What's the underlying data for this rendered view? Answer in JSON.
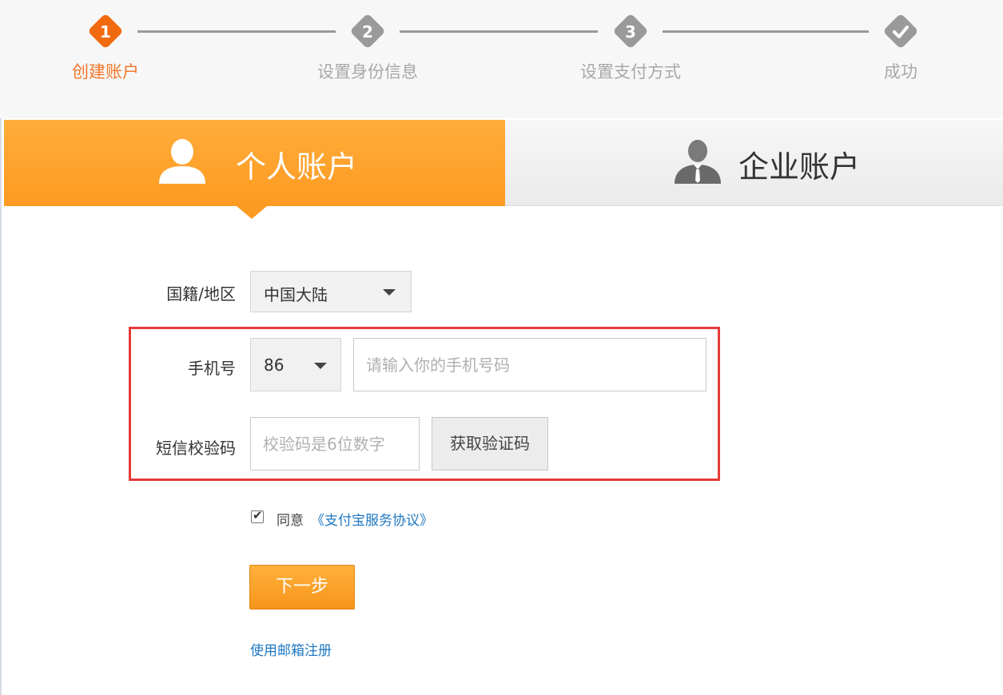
{
  "stepper": {
    "steps": [
      {
        "num": "1",
        "label": "创建账户",
        "state": "active"
      },
      {
        "num": "2",
        "label": "设置身份信息",
        "state": "pending"
      },
      {
        "num": "3",
        "label": "设置支付方式",
        "state": "pending"
      },
      {
        "num": "",
        "label": "成功",
        "state": "pending",
        "icon": "check-icon"
      }
    ]
  },
  "tabs": {
    "personal": {
      "label": "个人账户",
      "icon": "person-icon",
      "selected": true
    },
    "business": {
      "label": "企业账户",
      "icon": "businessman-icon",
      "selected": false
    }
  },
  "form": {
    "region": {
      "label": "国籍/地区",
      "value": "中国大陆"
    },
    "phone": {
      "label": "手机号",
      "country_code": "86",
      "placeholder": "请输入你的手机号码",
      "value": ""
    },
    "sms": {
      "label": "短信校验码",
      "placeholder": "校验码是6位数字",
      "value": "",
      "button": "获取验证码"
    },
    "agree": {
      "checked": true,
      "text": "同意",
      "link": "《支付宝服务协议》"
    },
    "next_button": "下一步",
    "email_link": "使用邮箱注册"
  },
  "colors": {
    "accent": "#fd9a21",
    "step_active": "#f26a10",
    "link": "#1f78c1",
    "highlight_frame": "#e63a3a"
  }
}
